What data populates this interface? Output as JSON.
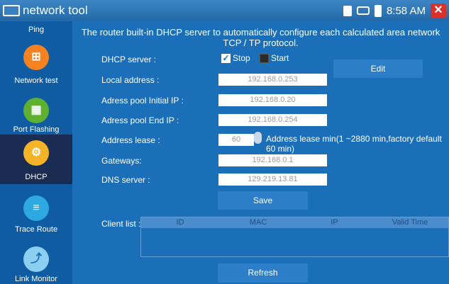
{
  "app": {
    "title": "network tool",
    "time": "8:58 AM",
    "close_glyph": "✕"
  },
  "status_icons": [
    "sd-card-icon",
    "usb-icon",
    "battery-icon",
    "close-icon"
  ],
  "sidebar": {
    "items": [
      {
        "label": "Ping",
        "icon": "ping-icon"
      },
      {
        "label": "Network test",
        "icon": "network-test-icon"
      },
      {
        "label": "Port Flashing",
        "icon": "port-flashing-icon"
      },
      {
        "label": "DHCP",
        "icon": "dhcp-icon",
        "selected": true
      },
      {
        "label": "Trace Route",
        "icon": "trace-route-icon"
      },
      {
        "label": "Link Monitor",
        "icon": "link-monitor-icon"
      }
    ]
  },
  "main": {
    "description": "The router built-in DHCP server to automatically configure each calculated area network TCP / TP protocol.",
    "dhcp_server": {
      "label": "DHCP server :",
      "stop_label": "Stop",
      "start_label": "Start",
      "stop_checked": true,
      "start_checked": false
    },
    "edit_button": "Edit",
    "local_address": {
      "label": "Local address :",
      "value": "192.168.0.253"
    },
    "pool_start": {
      "label": "Adress pool Initial IP :",
      "value": "192.168.0.20"
    },
    "pool_end": {
      "label": "Adress pool End IP :",
      "value": "192.168.0.254"
    },
    "lease": {
      "label": "Address lease :",
      "value": "60",
      "note": "Address lease min(1 ~2880 min,factory default 60 min)"
    },
    "gateways": {
      "label": "Gateways:",
      "value": "192.168.0.1"
    },
    "dns": {
      "label": "DNS server :",
      "value": "129.219.13.81"
    },
    "save_button": "Save",
    "client_list": {
      "label": "Client list :",
      "columns": [
        "ID",
        "MAC",
        "IP",
        "Valid Time"
      ],
      "rows": []
    },
    "refresh_button": "Refresh"
  },
  "colors": {
    "background": "#1a6fb8",
    "sidebar": "#0f5ca3",
    "selected": "#1a2c52",
    "close": "#d9302c"
  }
}
